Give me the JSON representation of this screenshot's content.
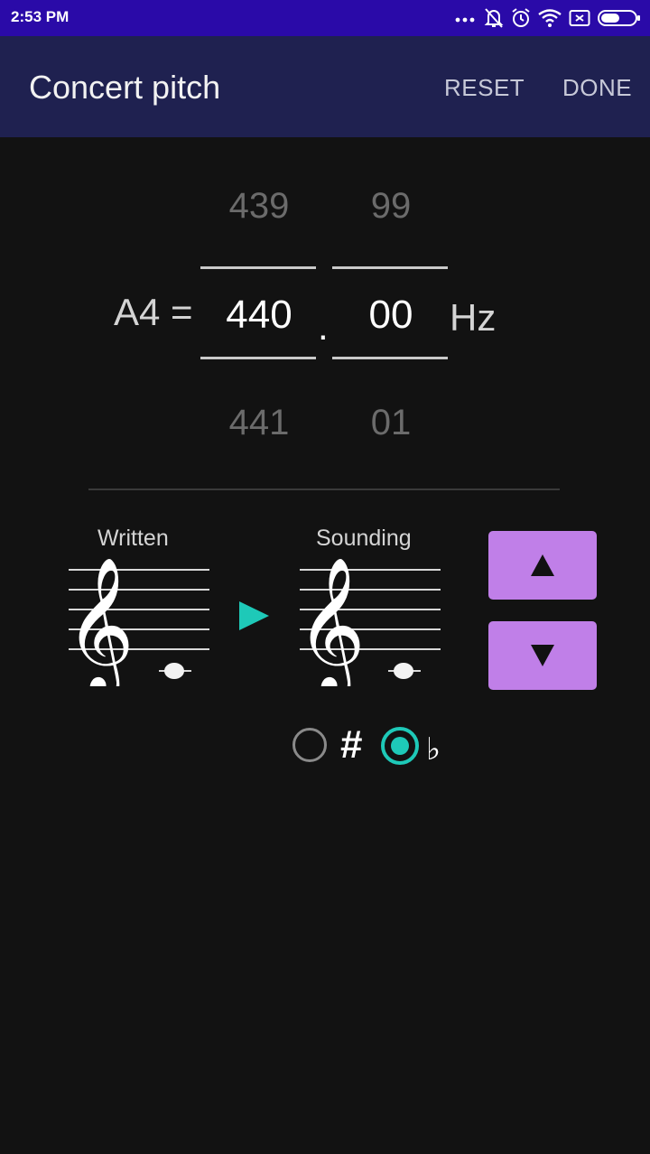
{
  "status_bar": {
    "time": "2:53 PM",
    "icons": [
      "more-icon",
      "bell-off-icon",
      "alarm-icon",
      "wifi-icon",
      "sim-icon",
      "battery-icon"
    ]
  },
  "app_bar": {
    "title": "Concert pitch",
    "reset_label": "RESET",
    "done_label": "DONE",
    "background": "#1f2150"
  },
  "pitch": {
    "note_label": "A4 =",
    "integer": {
      "prev": "439",
      "current": "440",
      "next": "441"
    },
    "decimal_point": ".",
    "fraction": {
      "prev": "99",
      "current": "00",
      "next": "01"
    },
    "unit": "Hz"
  },
  "transpose": {
    "written_label": "Written",
    "sounding_label": "Sounding",
    "arrow_color": "#1ec9b8",
    "up_button_icon": "triangle-up-icon",
    "down_button_icon": "triangle-down-icon",
    "button_color": "#c07fe8"
  },
  "accidentals": {
    "sharp_label": "#",
    "flat_label": "♭",
    "selected": "flat",
    "accent_color": "#1ec9b8"
  }
}
